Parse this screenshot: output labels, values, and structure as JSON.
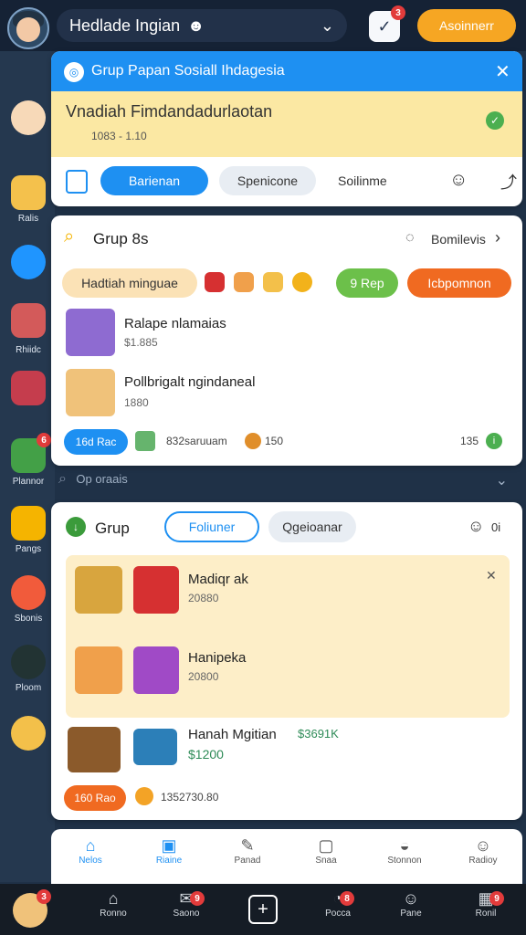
{
  "top": {
    "search_text": "Hedlade Ingian",
    "notif_badge": "3",
    "action_button": "Asoinnerr"
  },
  "popup": {
    "title": "Grup Papan Sosiall Ihdagesia",
    "banner_title": "Vnadiah Fimdandadurlaotan",
    "banner_sub": "1083 - 1.10",
    "actions": [
      "Barienan",
      "Spenicone",
      "Soilinme"
    ]
  },
  "sidebar": {
    "labels": [
      "Ralis",
      "Rhiidc",
      "Plannor",
      "Pangs",
      "Sbonis",
      "Ploom"
    ],
    "badge": "6"
  },
  "card1": {
    "title": "Grup 8s",
    "right_link": "Bomilevis",
    "chips": [
      "Hadtiah minguae",
      "9 Rep",
      "Icbpomnon"
    ],
    "rows": [
      {
        "name": "Ralape nlamaias",
        "value": "$1.885"
      },
      {
        "name": "Pollbrigalt ngindaneal",
        "value": "1880"
      }
    ],
    "footer_button": "16d Rac",
    "footer_text": "832saruuam",
    "footer_num": "150",
    "footer_right": "135"
  },
  "collapsed": {
    "label": "Op oraais"
  },
  "card2": {
    "title": "Grup",
    "follow": "Foliuner",
    "secondary": "Qgeioanar",
    "count": "0i",
    "items": [
      {
        "title": "Madiqr ak",
        "value": "20880"
      },
      {
        "title": "Hanipeka",
        "value": "20800"
      }
    ],
    "extra": {
      "title": "Hanah Mgitian",
      "badge": "$3691K",
      "value": "$1200"
    },
    "footer_button": "160 Rao",
    "footer_text": "1352730.80"
  },
  "nav": [
    "Nelos",
    "Riaine",
    "Panad",
    "Snaa",
    "Stonnon",
    "Radioy"
  ],
  "system": [
    "Ronno",
    "Saono",
    "Pocca",
    "Pane",
    "Ronil"
  ],
  "system_badges": [
    "3",
    "9",
    "8",
    "9",
    "9"
  ]
}
